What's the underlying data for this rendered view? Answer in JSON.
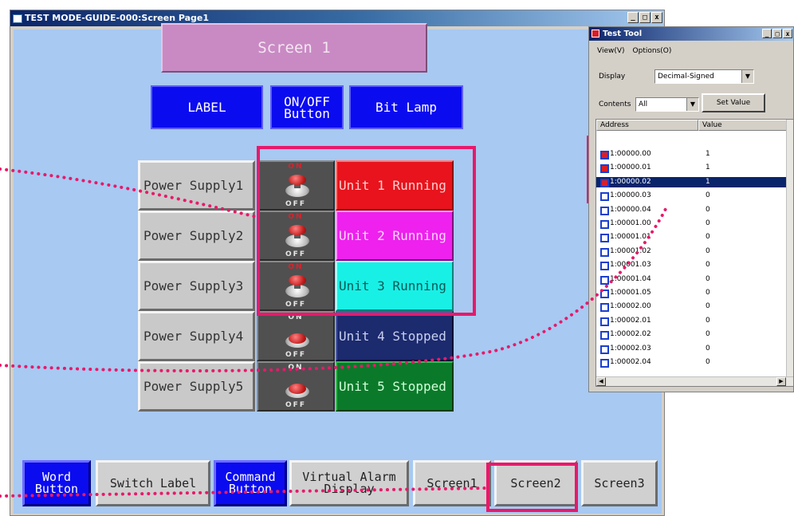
{
  "main_window": {
    "title": "TEST MODE-GUIDE-000:Screen Page1",
    "controls": [
      "_",
      "□",
      "x"
    ]
  },
  "screen": {
    "title_button": "Screen 1",
    "headers": [
      "LABEL",
      "ON/OFF Button",
      "Bit Lamp"
    ],
    "rows": [
      {
        "label": "Power Supply1",
        "switch_on": "ON",
        "switch_off": "OFF",
        "state": "on",
        "lamp": "Unit 1 Running",
        "lamp_color": "#e8131c"
      },
      {
        "label": "Power Supply2",
        "switch_on": "ON",
        "switch_off": "OFF",
        "state": "on",
        "lamp": "Unit 2 Running",
        "lamp_color": "#ee21ee"
      },
      {
        "label": "Power Supply3",
        "switch_on": "ON",
        "switch_off": "OFF",
        "state": "on",
        "lamp": "Unit 3 Running",
        "lamp_color": "#18f0e6"
      },
      {
        "label": "Power Supply4",
        "switch_on": "ON",
        "switch_off": "OFF",
        "state": "off",
        "lamp": "Unit 4 Stopped",
        "lamp_color": "#1c2a6e"
      },
      {
        "label": "Power Supply5",
        "switch_on": "ON",
        "switch_off": "OFF",
        "state": "off",
        "lamp": "Unit 5 Stopped",
        "lamp_color": "#0a7a2a"
      }
    ],
    "bottom_buttons": [
      {
        "label": "Word\nButton",
        "style": "blue"
      },
      {
        "label": "Switch Label",
        "style": "gray"
      },
      {
        "label": "Command\nButton",
        "style": "blue"
      },
      {
        "label": "Virtual Alarm\nDisplay",
        "style": "gray"
      },
      {
        "label": "Screen1",
        "style": "gray"
      },
      {
        "label": "Screen2",
        "style": "gray"
      },
      {
        "label": "Screen3",
        "style": "gray"
      }
    ]
  },
  "test_tool": {
    "title": "Test Tool",
    "controls": [
      "_",
      "□",
      "x"
    ],
    "menu": [
      "View(V)",
      "Options(O)"
    ],
    "display_label": "Display",
    "display_value": "Decimal-Signed",
    "contents_label": "Contents",
    "contents_value": "All",
    "set_value_button": "Set Value",
    "columns": [
      "Address",
      "Value"
    ],
    "rows": [
      {
        "address": "1:00000.00",
        "value": "1",
        "checked": true,
        "selected": false
      },
      {
        "address": "1:00000.01",
        "value": "1",
        "checked": true,
        "selected": false
      },
      {
        "address": "1:00000.02",
        "value": "1",
        "checked": true,
        "selected": true
      },
      {
        "address": "1:00000.03",
        "value": "0",
        "checked": false,
        "selected": false
      },
      {
        "address": "1:00000.04",
        "value": "0",
        "checked": false,
        "selected": false
      },
      {
        "address": "1:00001.00",
        "value": "0",
        "checked": false,
        "selected": false
      },
      {
        "address": "1:00001.01",
        "value": "0",
        "checked": false,
        "selected": false
      },
      {
        "address": "1:00001.02",
        "value": "0",
        "checked": false,
        "selected": false
      },
      {
        "address": "1:00001.03",
        "value": "0",
        "checked": false,
        "selected": false
      },
      {
        "address": "1:00001.04",
        "value": "0",
        "checked": false,
        "selected": false
      },
      {
        "address": "1:00001.05",
        "value": "0",
        "checked": false,
        "selected": false
      },
      {
        "address": "1:00002.00",
        "value": "0",
        "checked": false,
        "selected": false
      },
      {
        "address": "1:00002.01",
        "value": "0",
        "checked": false,
        "selected": false
      },
      {
        "address": "1:00002.02",
        "value": "0",
        "checked": false,
        "selected": false
      },
      {
        "address": "1:00002.03",
        "value": "0",
        "checked": false,
        "selected": false
      },
      {
        "address": "1:00002.04",
        "value": "0",
        "checked": false,
        "selected": false
      }
    ]
  },
  "colors": {
    "highlight": "#e8196a",
    "header_blue": "#0b0bf0",
    "screen_bg": "#a7c9f2"
  }
}
